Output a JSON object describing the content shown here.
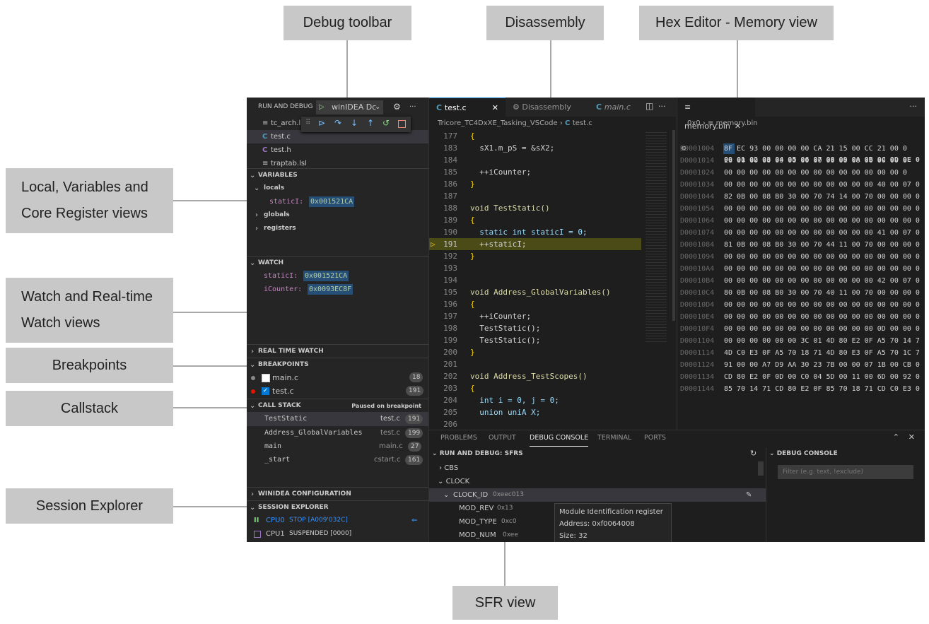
{
  "callouts": {
    "debug_toolbar": "Debug toolbar",
    "disassembly": "Disassembly",
    "hex_editor": "Hex Editor - Memory view",
    "local_vars_1": "Local, Variables and",
    "local_vars_2": "Core Register views",
    "watch_1": "Watch and Real-time",
    "watch_2": "Watch views",
    "breakpoints": "Breakpoints",
    "callstack": "Callstack",
    "session_explorer": "Session Explorer",
    "sfr_view": "SFR view"
  },
  "sidebar": {
    "run_and_debug": "RUN AND DEBUG",
    "config_name": "winIDEA Dc",
    "files": [
      "tc_arch.l",
      "test.c",
      "test.h",
      "traptab.lsl"
    ],
    "variables_header": "VARIABLES",
    "locals_label": "locals",
    "locals_var_name": "staticI:",
    "locals_var_value": "0x001521CA",
    "globals_label": "globals",
    "registers_label": "registers",
    "watch_header": "WATCH",
    "watch_items": [
      {
        "name": "staticI:",
        "value": "0x001521CA"
      },
      {
        "name": "iCounter:",
        "value": "0x0093EC8F"
      }
    ],
    "real_time_watch": "REAL TIME WATCH",
    "breakpoints_header": "BREAKPOINTS",
    "breakpoints": [
      {
        "file": "main.c",
        "line": "18"
      },
      {
        "file": "test.c",
        "line": "191"
      }
    ],
    "call_stack_header": "CALL STACK",
    "call_stack_status": "Paused on breakpoint",
    "call_stack": [
      {
        "fn": "TestStatic",
        "file": "test.c",
        "line": "191"
      },
      {
        "fn": "Address_GlobalVariables",
        "file": "test.c",
        "line": "199"
      },
      {
        "fn": "main",
        "file": "main.c",
        "line": "27"
      },
      {
        "fn": "_start",
        "file": "cstart.c",
        "line": "161"
      }
    ],
    "winidea_config": "WINIDEA CONFIGURATION",
    "session_explorer": "SESSION EXPLORER",
    "cpu0_name": "CPU0",
    "cpu0_status": "STOP [A009'032C]",
    "cpu1_name": "CPU1",
    "cpu1_status": "SUSPENDED [0000]"
  },
  "editor": {
    "tabs": [
      "test.c",
      "Disassembly",
      "main.c"
    ],
    "breadcrumb_path": "Tricore_TC4DxXE_Tasking_VSCode",
    "breadcrumb_file": "test.c",
    "lines": [
      {
        "n": "177",
        "code": "{"
      },
      {
        "n": "183",
        "code": "  sX1.m_pS = &sX2;"
      },
      {
        "n": "184",
        "code": ""
      },
      {
        "n": "185",
        "code": "  ++iCounter;"
      },
      {
        "n": "186",
        "code": "}"
      },
      {
        "n": "187",
        "code": ""
      },
      {
        "n": "188",
        "code": "void TestStatic()"
      },
      {
        "n": "189",
        "code": "{"
      },
      {
        "n": "190",
        "code": "  static int staticI = 0;"
      },
      {
        "n": "191",
        "code": "  ++staticI;"
      },
      {
        "n": "192",
        "code": "}"
      },
      {
        "n": "193",
        "code": ""
      },
      {
        "n": "194",
        "code": ""
      },
      {
        "n": "195",
        "code": "void Address_GlobalVariables()"
      },
      {
        "n": "196",
        "code": "{"
      },
      {
        "n": "197",
        "code": "  ++iCounter;"
      },
      {
        "n": "198",
        "code": "  TestStatic();"
      },
      {
        "n": "199",
        "code": "  TestStatic();"
      },
      {
        "n": "200",
        "code": "}"
      },
      {
        "n": "201",
        "code": ""
      },
      {
        "n": "202",
        "code": "void Address_TestScopes()"
      },
      {
        "n": "203",
        "code": "{"
      },
      {
        "n": "204",
        "code": "  int i = 0, j = 0;"
      },
      {
        "n": "205",
        "code": "  union uniA X;"
      },
      {
        "n": "206",
        "code": ""
      }
    ]
  },
  "hex": {
    "tab": "memory.bin",
    "breadcrumb_root": "0x0",
    "breadcrumb_file": "memory.bin",
    "header": "00 01 02 03 04 05 06 07 08 09 0A 0B 0C 0D 0E 0",
    "rows": [
      {
        "a": "D0001004",
        "b": "8F EC 93 00 00 00 00 CA 21 15 00 CC 21 00 0"
      },
      {
        "a": "D0001014",
        "b": "E6 00 00 00 00 00 00 00 00 00 00 00 00 00 0"
      },
      {
        "a": "D0001024",
        "b": "00 00 00 00 00 00 00 00 00 00 00 00 00 00 0"
      },
      {
        "a": "D0001034",
        "b": "00 00 00 00 00 00 00 00 00 00 00 00 40 00 07 0"
      },
      {
        "a": "D0001044",
        "b": "82 0B 00 08 B0 30 00 70 74 14 00 70 00 00 00 0"
      },
      {
        "a": "D0001054",
        "b": "00 00 00 00 00 00 00 00 00 00 00 00 00 00 00 0"
      },
      {
        "a": "D0001064",
        "b": "00 00 00 00 00 00 00 00 00 00 00 00 00 00 00 0"
      },
      {
        "a": "D0001074",
        "b": "00 00 00 00 00 00 00 00 00 00 00 00 41 00 07 0"
      },
      {
        "a": "D0001084",
        "b": "81 0B 00 08 B0 30 00 70 44 11 00 70 00 00 00 0"
      },
      {
        "a": "D0001094",
        "b": "00 00 00 00 00 00 00 00 00 00 00 00 00 00 00 0"
      },
      {
        "a": "D00010A4",
        "b": "00 00 00 00 00 00 00 00 00 00 00 00 00 00 00 0"
      },
      {
        "a": "D00010B4",
        "b": "00 00 00 00 00 00 00 00 00 00 00 00 42 00 07 0"
      },
      {
        "a": "D00010C4",
        "b": "80 0B 00 08 B0 30 00 70 40 11 00 70 00 00 00 0"
      },
      {
        "a": "D00010D4",
        "b": "00 00 00 00 00 00 00 00 00 00 00 00 00 00 00 0"
      },
      {
        "a": "D00010E4",
        "b": "00 00 00 00 00 00 00 00 00 00 00 00 00 00 00 0"
      },
      {
        "a": "D00010F4",
        "b": "00 00 00 00 00 00 00 00 00 00 00 00 0D 00 00 0"
      },
      {
        "a": "D0001104",
        "b": "00 00 00 00 00 00 3C 01 4D 80 E2 0F A5 70 14 7"
      },
      {
        "a": "D0001114",
        "b": "4D C0 E3 0F A5 70 18 71 4D 80 E3 0F A5 70 1C 7"
      },
      {
        "a": "D0001124",
        "b": "91 00 00 A7 D9 AA 30 23 7B 00 00 07 1B 00 CB 0"
      },
      {
        "a": "D0001134",
        "b": "CD 80 E2 0F 0D 00 C0 04 5D 00 11 00 6D 00 92 0"
      },
      {
        "a": "D0001144",
        "b": "85 70 14 71 CD 80 E2 0F 85 70 18 71 CD C0 E3 0"
      }
    ]
  },
  "panel": {
    "tabs": [
      "PROBLEMS",
      "OUTPUT",
      "DEBUG CONSOLE",
      "TERMINAL",
      "PORTS"
    ],
    "sfr_header": "RUN AND DEBUG: SFRS",
    "sfr_items": [
      {
        "label": "CBS",
        "value": ""
      },
      {
        "label": "CLOCK",
        "value": ""
      },
      {
        "label": "CLOCK_ID",
        "value": "0xeec013"
      },
      {
        "label": "MOD_REV",
        "value": "0x13"
      },
      {
        "label": "MOD_TYPE",
        "value": "0xc0"
      },
      {
        "label": "MOD_NUM",
        "value": "0xee"
      }
    ],
    "tooltip_title": "Module Identification register",
    "tooltip_address": "Address: 0xf0064008",
    "tooltip_size": "Size: 32",
    "console_header": "DEBUG CONSOLE",
    "filter_placeholder": "Filter (e.g. text, !exclude)"
  }
}
